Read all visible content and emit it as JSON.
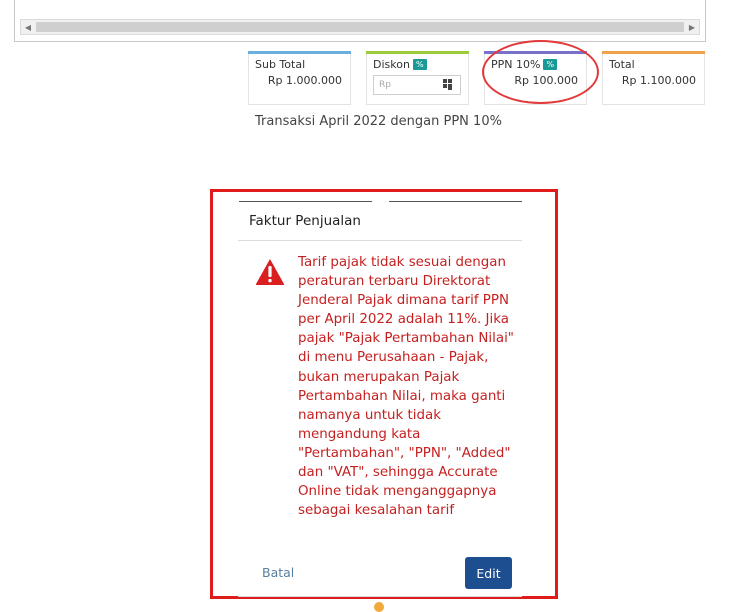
{
  "summary": {
    "subtotal": {
      "label": "Sub Total",
      "value": "Rp 1.000.000",
      "accent": "#6ab0de"
    },
    "diskon": {
      "label": "Diskon",
      "badge": "%",
      "placeholder": "Rp",
      "accent": "#9ccc3c"
    },
    "ppn": {
      "label": "PPN 10%",
      "badge": "%",
      "value": "Rp 100.000",
      "accent": "#7a6fc9"
    },
    "total": {
      "label": "Total",
      "value": "Rp 1.100.000",
      "accent": "#f0a24a"
    }
  },
  "caption": "Transaksi April 2022 dengan PPN 10%",
  "dialog": {
    "title": "Faktur Penjualan",
    "icon": "warning-triangle-icon",
    "message": "Tarif pajak tidak sesuai dengan peraturan terbaru Direktorat Jenderal Pajak dimana tarif PPN per April 2022 adalah 11%. Jika pajak \"Pajak Pertambahan Nilai\" di menu Perusahaan - Pajak, bukan merupakan Pajak Pertambahan Nilai, maka ganti namanya untuk tidak mengandung kata \"Pertambahan\", \"PPN\", \"Added\" dan \"VAT\", sehingga Accurate Online tidak menganggapnya sebagai kesalahan tarif",
    "cancel_label": "Batal",
    "edit_label": "Edit"
  },
  "colors": {
    "message": "#c52020",
    "edit_button": "#1d4e8f",
    "highlight": "#e01b1b",
    "badge": "#1a9a96"
  }
}
